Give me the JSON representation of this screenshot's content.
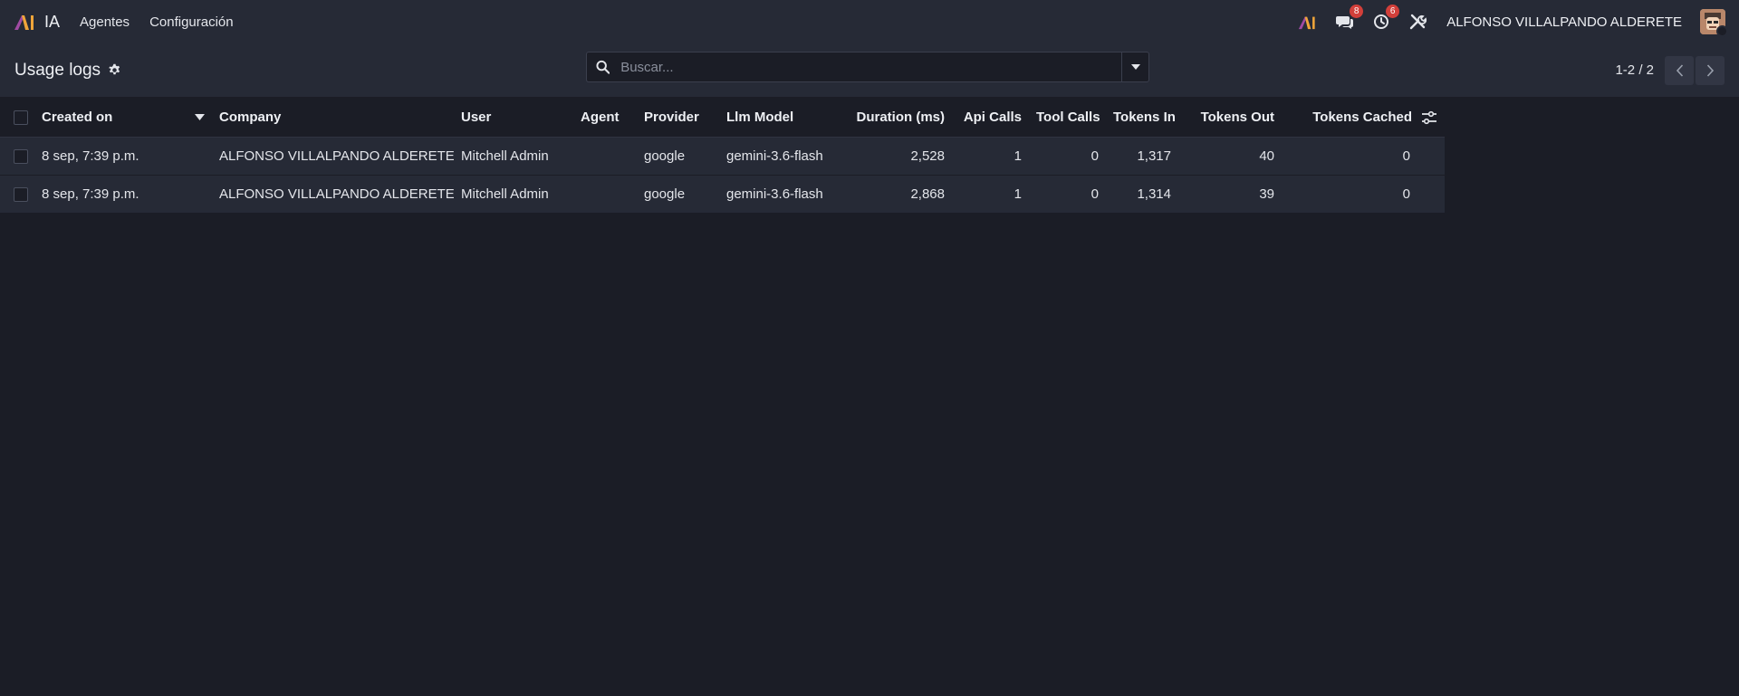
{
  "app": {
    "name": "IA"
  },
  "navbar": {
    "menu": [
      "Agentes",
      "Configuración"
    ],
    "messages_count": "8",
    "activities_count": "6",
    "user_name": "ALFONSO VILLALPANDO ALDERETE"
  },
  "control_panel": {
    "breadcrumb": "Usage logs",
    "search_placeholder": "Buscar...",
    "pager_value": "1-2 / 2"
  },
  "table": {
    "columns": [
      "Created on",
      "Company",
      "User",
      "Agent",
      "Provider",
      "Llm Model",
      "Duration (ms)",
      "Api Calls",
      "Tool Calls",
      "Tokens In",
      "Tokens Out",
      "Tokens Cached"
    ],
    "rows": [
      [
        "8 sep, 7:39 p.m.",
        "ALFONSO VILLALPANDO ALDERETE",
        "Mitchell Admin",
        "",
        "google",
        "gemini-3.6-flash",
        "2,528",
        "1",
        "0",
        "1,317",
        "40",
        "0"
      ],
      [
        "8 sep, 7:39 p.m.",
        "ALFONSO VILLALPANDO ALDERETE",
        "Mitchell Admin",
        "",
        "google",
        "gemini-3.6-flash",
        "2,868",
        "1",
        "0",
        "1,314",
        "39",
        "0"
      ]
    ]
  },
  "colors": {
    "background": "#1b1d26",
    "panel": "#262a36",
    "badge": "#d23f3a",
    "brand_purple": "#a04aa3",
    "brand_orange": "#f0a53a"
  },
  "icons": {
    "brand": "app-logo-icon",
    "messages": "chat-bubbles-icon",
    "activities": "clock-icon",
    "debug": "tools-icon",
    "settings": "gear-icon",
    "search": "search-icon",
    "toggle": "caret-down-icon",
    "prev": "chevron-left-icon",
    "next": "chevron-right-icon",
    "sort": "sort-desc-icon",
    "optional_columns": "sliders-icon"
  }
}
